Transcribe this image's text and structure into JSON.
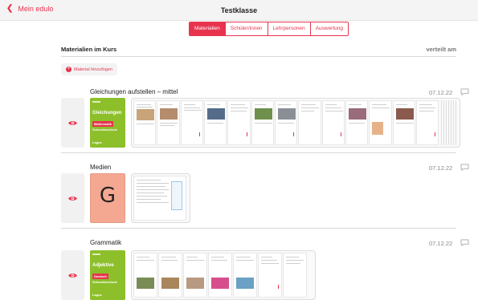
{
  "nav": {
    "back_label": "Mein edulo",
    "title": "Testklasse"
  },
  "tabs": [
    {
      "label": "Materialien",
      "active": true
    },
    {
      "label": "Schüler/innen",
      "active": false
    },
    {
      "label": "Lehrpersonen",
      "active": false
    },
    {
      "label": "Auswertung",
      "active": false
    }
  ],
  "section": {
    "title": "Materialien im Kurs",
    "column_right": "verteilt am",
    "add_button": "Material hinzufügen"
  },
  "courses": [
    {
      "name": "Gleichungen aufstellen – mittel",
      "date": "07.12.22",
      "cover": {
        "title": "Gleichungen",
        "tag": "Mathematik",
        "level": "Sekundarschule",
        "publisher": "Lagus"
      }
    },
    {
      "name": "Medien",
      "date": "07.12.22",
      "cover": {
        "letter": "G"
      }
    },
    {
      "name": "Grammatik",
      "date": "07.12.22",
      "cover": {
        "title": "Adjektive",
        "tag": "Deutsch",
        "level": "Sekundarschule",
        "publisher": "Lagus"
      }
    }
  ],
  "colors": {
    "accent": "#e8334f",
    "green": "#8dbf2b",
    "peach": "#f4a891"
  }
}
